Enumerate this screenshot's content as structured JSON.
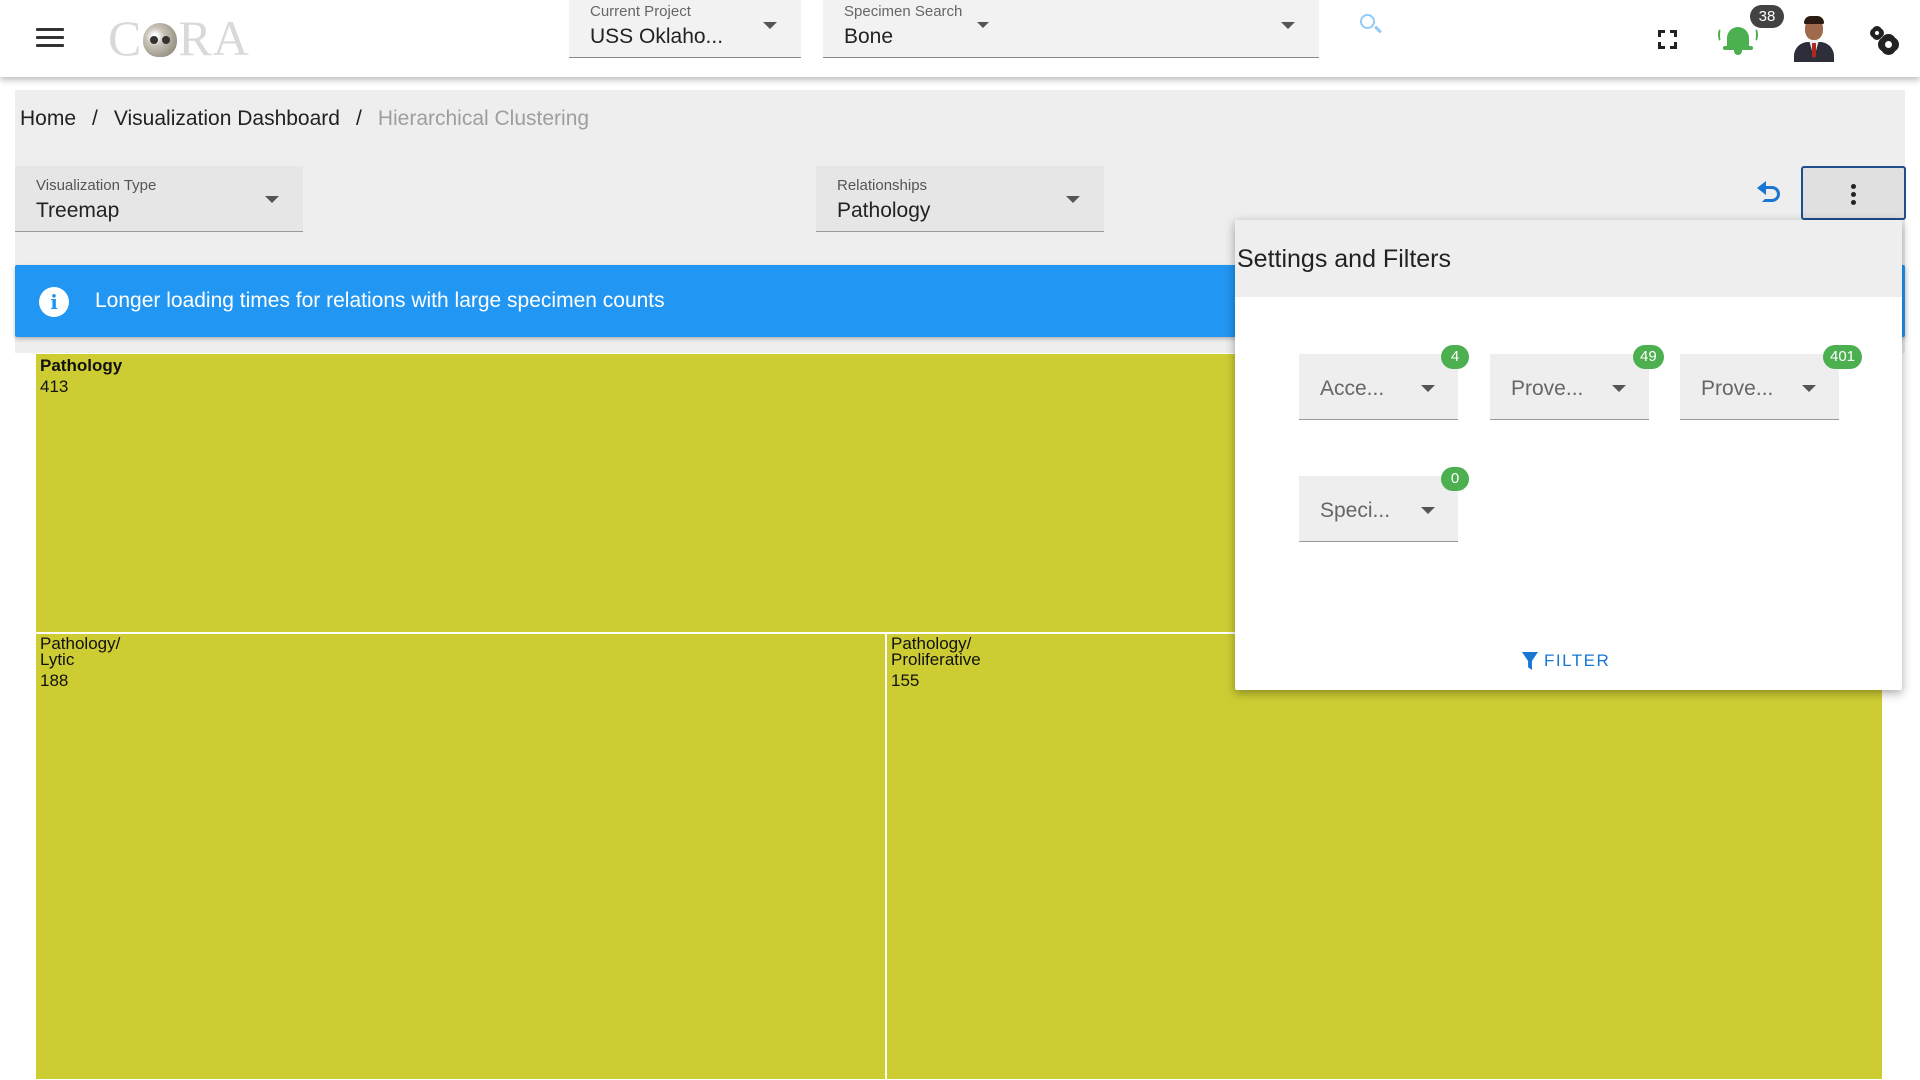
{
  "header": {
    "logo_text_left": "C",
    "logo_text_right": "RA",
    "current_project": {
      "label": "Current Project",
      "value": "USS Oklaho..."
    },
    "specimen_search": {
      "label": "Specimen Search",
      "value": "Bone"
    },
    "notification_count": "38"
  },
  "breadcrumb": {
    "items": [
      "Home",
      "Visualization Dashboard",
      "Hierarchical Clustering"
    ],
    "separator": "/"
  },
  "controls": {
    "visualization_type": {
      "label": "Visualization Type",
      "value": "Treemap"
    },
    "relationships": {
      "label": "Relationships",
      "value": "Pathology"
    }
  },
  "banner": {
    "message": "Longer loading times for relations with large specimen counts",
    "icon": "info-icon"
  },
  "panel": {
    "title": "Settings and Filters",
    "filters": [
      {
        "value": "Acce...",
        "count": "4"
      },
      {
        "value": "Prove...",
        "count": "49"
      },
      {
        "value": "Prove...",
        "count": "401"
      },
      {
        "value": "Speci...",
        "count": "0"
      }
    ],
    "filter_button": "FILTER"
  },
  "chart_data": {
    "type": "treemap",
    "color": "#cdcd33",
    "nodes": [
      {
        "name": "Pathology",
        "value": 413,
        "level": 0
      },
      {
        "name_lines": [
          "Pathology/",
          "Lytic"
        ],
        "value": 188,
        "level": 1
      },
      {
        "name_lines": [
          "Pathology/",
          "Proliferative"
        ],
        "value": 155,
        "level": 1
      }
    ]
  }
}
